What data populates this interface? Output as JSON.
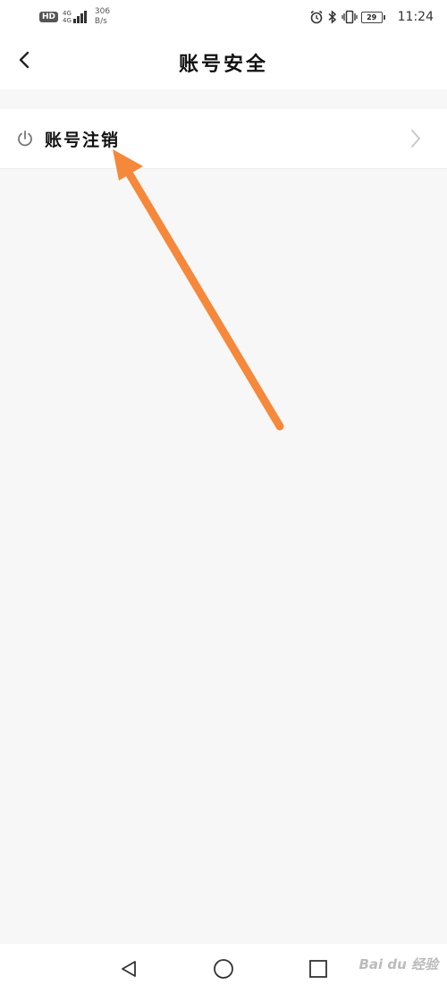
{
  "status_bar": {
    "hd_label": "HD",
    "network_top": "4G",
    "network_bottom": "4G",
    "speed_value": "306",
    "speed_unit": "B/s",
    "icons": [
      "alarm-icon",
      "bluetooth-icon",
      "vibrate-icon"
    ],
    "battery_level": "29",
    "time": "11:24"
  },
  "header": {
    "title": "账号安全",
    "back_icon": "chevron-left-icon"
  },
  "settings_list": {
    "items": [
      {
        "label": "账号注销",
        "icon": "power-icon",
        "trailing_icon": "chevron-right-icon"
      }
    ]
  },
  "nav_bar": {
    "buttons": [
      "back-triangle-icon",
      "home-circle-icon",
      "recents-square-icon"
    ]
  },
  "watermark": {
    "text": "Bai du 经验"
  },
  "colors": {
    "background": "#f7f7f7",
    "surface": "#ffffff",
    "annotation_arrow": "#f5883a",
    "icon_gray": "#888888"
  }
}
